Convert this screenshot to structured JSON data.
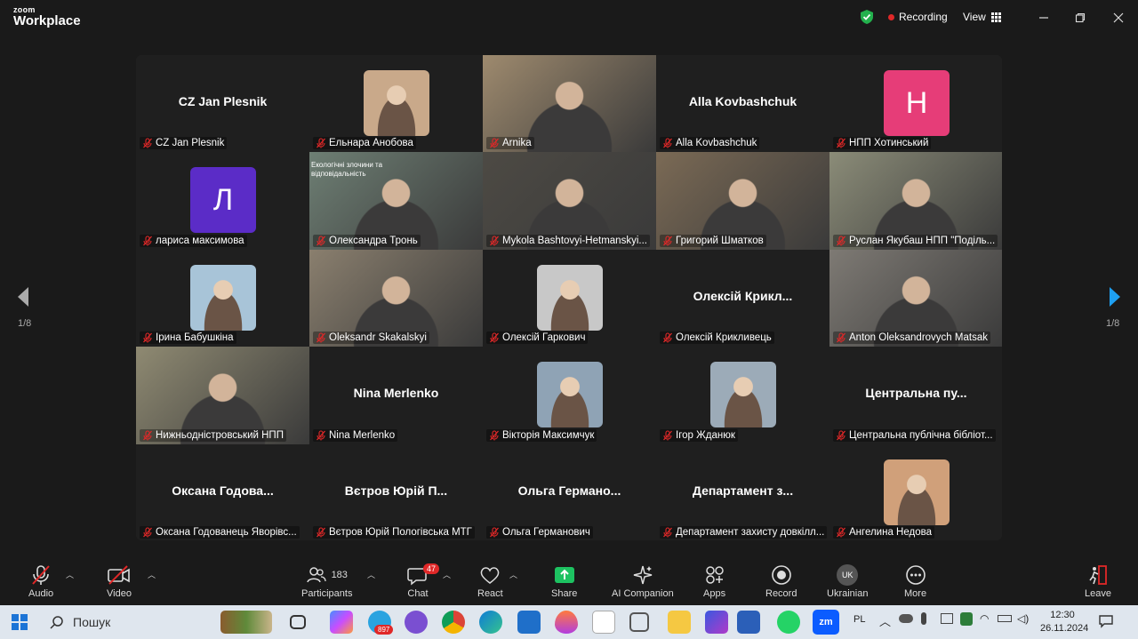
{
  "app": {
    "brand_top": "zoom",
    "brand_bottom": "Workplace"
  },
  "titlebar": {
    "recording_label": "Recording",
    "view_label": "View"
  },
  "pager": {
    "left": "1/8",
    "right": "1/8"
  },
  "tiles": [
    {
      "kind": "name",
      "center": "CZ Jan Plesnik",
      "label": "CZ Jan Plesnik"
    },
    {
      "kind": "photo",
      "label": "Ельнара Анобова",
      "photo_color": "#c9a98a"
    },
    {
      "kind": "video",
      "label": "Arnika",
      "photo_color": "#9e8a6e"
    },
    {
      "kind": "name",
      "center": "Alla Kovbashchuk",
      "label": "Alla Kovbashchuk"
    },
    {
      "kind": "avatar",
      "letter": "Н",
      "avatar_color": "#e63d78",
      "label": "НПП Хотинський"
    },
    {
      "kind": "avatar",
      "letter": "Л",
      "avatar_color": "#5b2cc7",
      "label": "лариса максимова"
    },
    {
      "kind": "video",
      "label": "Олександра Тронь",
      "photo_color": "#6e7f74",
      "slide_title": "Екологічні злочини та відповідальність"
    },
    {
      "kind": "video",
      "label": "Mykola Bashtovyi-Hetmanskyi...",
      "photo_color": "#4d4a44"
    },
    {
      "kind": "video",
      "label": "Григорий Шматков",
      "photo_color": "#7b6a55"
    },
    {
      "kind": "video",
      "label": "Руслан Якубаш НПП \"Поділь...",
      "photo_color": "#8b8c78"
    },
    {
      "kind": "photo",
      "label": "Ірина Бабушкіна",
      "photo_color": "#a8c4d8"
    },
    {
      "kind": "video",
      "label": "Oleksandr Skakalskyi",
      "photo_color": "#8a7f6e",
      "active": true
    },
    {
      "kind": "photo",
      "label": "Олексій Гаркович",
      "photo_color": "#c8c8c8"
    },
    {
      "kind": "name",
      "center": "Олексій  Крикл...",
      "label": "Олексій Крикливець"
    },
    {
      "kind": "video",
      "label": "Anton Oleksandrovych Matsak",
      "photo_color": "#7e7a74"
    },
    {
      "kind": "video",
      "label": "Нижньодністровський НПП",
      "photo_color": "#8f8a72"
    },
    {
      "kind": "name",
      "center": "Nina Merlenko",
      "label": "Nina Merlenko"
    },
    {
      "kind": "photo",
      "label": "Вікторія Максимчук",
      "photo_color": "#8fa3b5"
    },
    {
      "kind": "photo",
      "label": "Ігор Жданюк",
      "photo_color": "#9cabb8"
    },
    {
      "kind": "name",
      "center": "Центральна  пу...",
      "label": "Центральна публічна бібліот..."
    },
    {
      "kind": "name",
      "center": "Оксана  Годова...",
      "label": "Оксана Годованець Яворівс..."
    },
    {
      "kind": "name",
      "center": "Вєтров  Юрій  П...",
      "label": "Вєтров Юрій Пологівська МТГ"
    },
    {
      "kind": "name",
      "center": "Ольга  Германо...",
      "label": "Ольга Германович"
    },
    {
      "kind": "name",
      "center": "Департамент  з...",
      "label": "Департамент захисту довкілл..."
    },
    {
      "kind": "photo",
      "label": "Ангелина Недова",
      "photo_color": "#d0a07a"
    }
  ],
  "toolbar": {
    "audio": "Audio",
    "video": "Video",
    "participants": "Participants",
    "participants_count": "183",
    "chat": "Chat",
    "chat_badge": "47",
    "react": "React",
    "share": "Share",
    "ai": "AI Companion",
    "apps": "Apps",
    "record": "Record",
    "lang_code": "UK",
    "lang": "Ukrainian",
    "more": "More",
    "leave": "Leave"
  },
  "taskbar": {
    "search_placeholder": "Пошук",
    "telegram_badge": "897",
    "lang": "PL",
    "time": "12:30",
    "date": "26.11.2024"
  },
  "colors": {
    "accent_green": "#2ecf8a",
    "share_green": "#1dc261",
    "badge_red": "#e02828",
    "arrow_blue": "#1ea0f2"
  }
}
